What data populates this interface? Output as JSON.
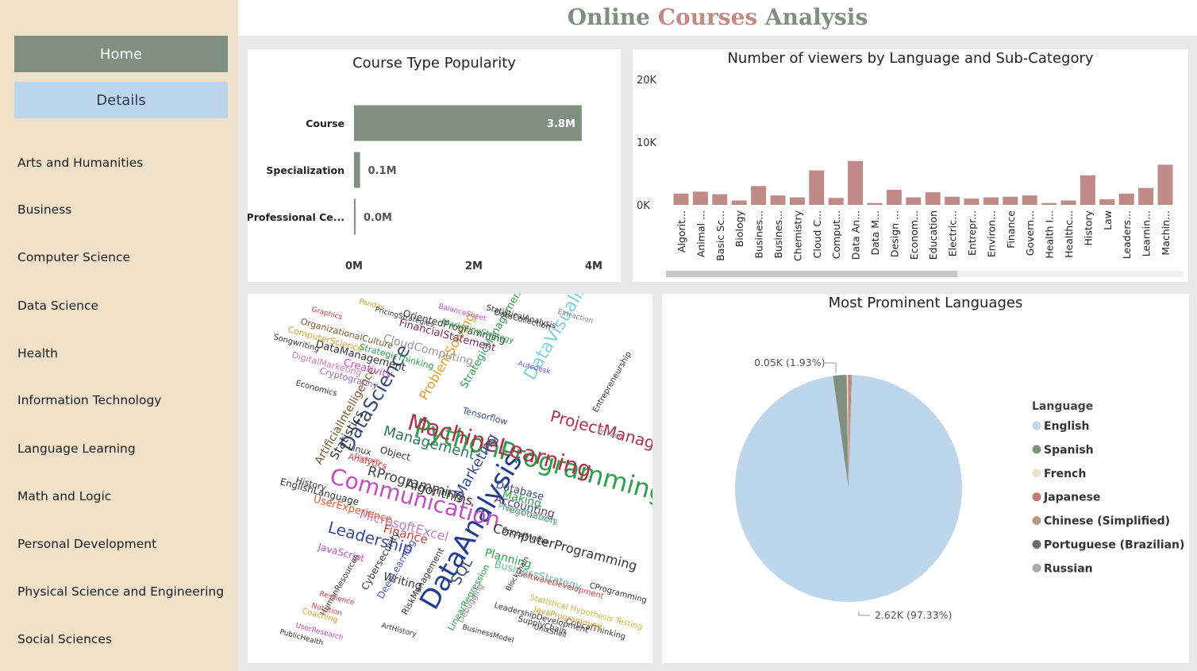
{
  "header": {
    "title_words": [
      "Online",
      "Courses",
      "Analysis"
    ],
    "title_colors": [
      "#7f9080",
      "#c48a86",
      "#7f9080"
    ]
  },
  "sidebar": {
    "home_label": "Home",
    "details_label": "Details",
    "items": [
      {
        "label": "Arts and Humanities"
      },
      {
        "label": "Business"
      },
      {
        "label": "Computer Science"
      },
      {
        "label": "Data Science"
      },
      {
        "label": "Health"
      },
      {
        "label": "Information Technology"
      },
      {
        "label": "Language Learning"
      },
      {
        "label": "Math and Logic"
      },
      {
        "label": "Personal Development"
      },
      {
        "label": "Physical Science and Engineering"
      },
      {
        "label": "Social Sciences"
      }
    ]
  },
  "colors": {
    "bar_green": "#7f9080",
    "bar_rose": "#c08a87",
    "english": "#bdd6ec",
    "spanish": "#7f9080",
    "french": "#f0e1cb",
    "japanese": "#c27c78",
    "chinese": "#b89a86",
    "portuguese": "#6b6b6b",
    "russian": "#aaaaaa"
  },
  "chart_data": [
    {
      "type": "bar",
      "title": "Course Type Popularity",
      "orientation": "horizontal",
      "categories": [
        "Course",
        "Specialization",
        "Professional Ce..."
      ],
      "values": [
        3.8,
        0.1,
        0.0
      ],
      "value_labels": [
        "3.8M",
        "0.1M",
        "0.0M"
      ],
      "xlim": [
        0,
        4
      ],
      "xticks": [
        "0M",
        "2M",
        "4M"
      ]
    },
    {
      "type": "bar",
      "title": "Number of viewers by Language and Sub-Category",
      "categories": [
        "Algorit...",
        "Animal ...",
        "Basic Sc...",
        "Biology",
        "Busines...",
        "Busines...",
        "Chemistry",
        "Cloud C...",
        "Comput...",
        "Data An...",
        "Data M...",
        "Design ...",
        "Econom...",
        "Education",
        "Electric...",
        "Entrepr...",
        "Environ...",
        "Finance",
        "Govern...",
        "Health I...",
        "Healthc...",
        "History",
        "Law",
        "Leaders...",
        "Learnin...",
        "Machin..."
      ],
      "values": [
        1800,
        2100,
        1700,
        700,
        3000,
        1500,
        1200,
        5500,
        1100,
        7000,
        300,
        2400,
        1200,
        2000,
        1300,
        1000,
        1200,
        1300,
        1500,
        300,
        700,
        4700,
        900,
        1800,
        2700,
        6400
      ],
      "ylim": [
        0,
        20000
      ],
      "yticks": [
        "0K",
        "10K",
        "20K"
      ]
    },
    {
      "type": "pie",
      "title": "Most Prominent Languages",
      "legend_title": "Language",
      "legend_position": "right",
      "labels": [
        "English",
        "Spanish",
        "French",
        "Japanese",
        "Chinese (Simplified)",
        "Portuguese (Brazilian)",
        "Russian"
      ],
      "percents": [
        97.33,
        1.93,
        0.2,
        0.3,
        0.12,
        0.07,
        0.05
      ],
      "annotations": [
        "2.62K (97.33%)",
        "0.05K (1.93%)"
      ]
    }
  ],
  "wordcloud": {
    "words": [
      {
        "t": "DataAnalysis",
        "s": 34,
        "c": "#1f3a93",
        "r": -60
      },
      {
        "t": "PythonProgramming",
        "s": 32,
        "c": "#2e9e4a",
        "r": 15
      },
      {
        "t": "MachineLearning",
        "s": 28,
        "c": "#b0304a",
        "r": 15
      },
      {
        "t": "Communication",
        "s": 28,
        "c": "#c04fc0",
        "r": 15
      },
      {
        "t": "DataScience",
        "s": 24,
        "c": "#3a4a7a",
        "r": -60
      },
      {
        "t": "ProjectManagement",
        "s": 20,
        "c": "#b0304a",
        "r": 15
      },
      {
        "t": "DataVisualization",
        "s": 22,
        "c": "#7fd0e0",
        "r": -60
      },
      {
        "t": "Leadership",
        "s": 20,
        "c": "#3a4a9a",
        "r": 15
      },
      {
        "t": "Management",
        "s": 18,
        "c": "#2e7a5a",
        "r": 15
      },
      {
        "t": "ComputerProgramming",
        "s": 16,
        "c": "#333333",
        "r": 15
      },
      {
        "t": "MicrosoftExcel",
        "s": 16,
        "c": "#c080c0",
        "r": 15
      },
      {
        "t": "RProgramming",
        "s": 17,
        "c": "#444444",
        "r": 15
      },
      {
        "t": "Algorithms",
        "s": 16,
        "c": "#333333",
        "r": 15
      },
      {
        "t": "Marketing",
        "s": 18,
        "c": "#3a4a9a",
        "r": -60
      },
      {
        "t": "ProblemSolving",
        "s": 16,
        "c": "#e0a030",
        "r": -60
      },
      {
        "t": "Accounting",
        "s": 14,
        "c": "#5a3a7a",
        "r": 15
      },
      {
        "t": "Finance",
        "s": 15,
        "c": "#d04040",
        "r": 15
      },
      {
        "t": "Statistics",
        "s": 15,
        "c": "#333333",
        "r": -60
      },
      {
        "t": "ArtificialIntelligence",
        "s": 14,
        "c": "#7a5a2a",
        "r": -60
      },
      {
        "t": "UserExperience",
        "s": 13,
        "c": "#e05a30",
        "r": 15
      },
      {
        "t": "DataManagement",
        "s": 13,
        "c": "#333333",
        "r": 15
      },
      {
        "t": "CloudComputing",
        "s": 14,
        "c": "#999999",
        "r": 15
      },
      {
        "t": "StrategicManagement",
        "s": 13,
        "c": "#2e9e4a",
        "r": -60
      },
      {
        "t": "FinancialStatement",
        "s": 13,
        "c": "#7a2a5a",
        "r": 15
      },
      {
        "t": "OrientedProgramming",
        "s": 12,
        "c": "#333333",
        "r": 15
      },
      {
        "t": "Planning",
        "s": 14,
        "c": "#2e9e4a",
        "r": 15
      },
      {
        "t": "BusinessStrategy",
        "s": 13,
        "c": "#60c0a0",
        "r": 15
      },
      {
        "t": "Writing",
        "s": 14,
        "c": "#333333",
        "r": 15
      },
      {
        "t": "Cybersecurity",
        "s": 12,
        "c": "#333333",
        "r": -60
      },
      {
        "t": "DeepLearning",
        "s": 12,
        "c": "#4a5ac0",
        "r": -60
      },
      {
        "t": "Negotiation",
        "s": 12,
        "c": "#888888",
        "r": 15
      },
      {
        "t": "Database",
        "s": 13,
        "c": "#3a4a7a",
        "r": 15
      },
      {
        "t": "Making",
        "s": 14,
        "c": "#2e9e4a",
        "r": 15
      },
      {
        "t": "EnglishLanguage",
        "s": 12,
        "c": "#333333",
        "r": 15
      },
      {
        "t": "Creativity",
        "s": 13,
        "c": "#c04fc0",
        "r": 15
      },
      {
        "t": "Cryptography",
        "s": 11,
        "c": "#9a6ac0",
        "r": 15
      },
      {
        "t": "DigitalMarketing",
        "s": 11,
        "c": "#d080a0",
        "r": 15
      },
      {
        "t": "StrategicThinking",
        "s": 11,
        "c": "#2e9e4a",
        "r": 15
      },
      {
        "t": "JavaScript",
        "s": 12,
        "c": "#c04fc0",
        "r": 15
      },
      {
        "t": "SQL",
        "s": 18,
        "c": "#3a4a7a",
        "r": -60
      },
      {
        "t": "SoftwareDevelopment",
        "s": 10,
        "c": "#d04040",
        "r": 15
      },
      {
        "t": "HumanResources",
        "s": 10,
        "c": "#333333",
        "r": -60
      },
      {
        "t": "RiskManagement",
        "s": 11,
        "c": "#333333",
        "r": -60
      },
      {
        "t": "LinearRegression",
        "s": 11,
        "c": "#2e9e4a",
        "r": -60
      },
      {
        "t": "StatisticalAnalysis",
        "s": 10,
        "c": "#333333",
        "r": 15
      },
      {
        "t": "OrganizationalCulture",
        "s": 11,
        "c": "#7a5a2a",
        "r": 15
      },
      {
        "t": "ComputerScience",
        "s": 11,
        "c": "#e0a030",
        "r": 15
      },
      {
        "t": "MarketingStrategy",
        "s": 10,
        "c": "#2e9e4a",
        "r": 15
      },
      {
        "t": "Economics",
        "s": 10,
        "c": "#333333",
        "r": 15
      },
      {
        "t": "Songwriting",
        "s": 10,
        "c": "#333333",
        "r": 15
      },
      {
        "t": "SupplyChain",
        "s": 10,
        "c": "#333333",
        "r": 15
      },
      {
        "t": "CriticalThinking",
        "s": 10,
        "c": "#333333",
        "r": 15
      },
      {
        "t": "Tensorflow",
        "s": 11,
        "c": "#3a4a9a",
        "r": 15
      },
      {
        "t": "ProjectPlanning",
        "s": 10,
        "c": "#60c0a0",
        "r": 15
      },
      {
        "t": "SocialMedia",
        "s": 10,
        "c": "#333333",
        "r": 15
      },
      {
        "t": "Linux",
        "s": 11,
        "c": "#333333",
        "r": 15
      },
      {
        "t": "Analytics",
        "s": 11,
        "c": "#d04040",
        "r": 15
      },
      {
        "t": "Object",
        "s": 12,
        "c": "#333333",
        "r": 15
      },
      {
        "t": "Debugging",
        "s": 10,
        "c": "#888888",
        "r": -60
      },
      {
        "t": "ArtHistory",
        "s": 9,
        "c": "#333333",
        "r": 15
      },
      {
        "t": "Pandas",
        "s": 9,
        "c": "#e0a030",
        "r": 15
      },
      {
        "t": "Graphics",
        "s": 9,
        "c": "#d04040",
        "r": 15
      },
      {
        "t": "PricingStrategies",
        "s": 9,
        "c": "#333333",
        "r": 15
      },
      {
        "t": "BalanceSheet",
        "s": 9,
        "c": "#c04fc0",
        "r": 15
      },
      {
        "t": "DataCollection",
        "s": 10,
        "c": "#333333",
        "r": 15
      },
      {
        "t": "Extraction",
        "s": 9,
        "c": "#888888",
        "r": 15
      },
      {
        "t": "Autodesk",
        "s": 9,
        "c": "#6a5ac0",
        "r": 15
      },
      {
        "t": "History",
        "s": 11,
        "c": "#333333",
        "r": 15
      },
      {
        "t": "Coaching",
        "s": 10,
        "c": "#e0a030",
        "r": 15
      },
      {
        "t": "Entrepreneurship",
        "s": 10,
        "c": "#333333",
        "r": -60
      },
      {
        "t": "Privacy",
        "s": 9,
        "c": "#888888",
        "r": 15
      },
      {
        "t": "Blockchain",
        "s": 9,
        "c": "#333333",
        "r": -60
      },
      {
        "t": "Statistical Hypothesis Testing",
        "s": 10,
        "c": "#c0c040",
        "r": 15
      },
      {
        "t": "JavaProgramming",
        "s": 10,
        "c": "#e0a030",
        "r": 15
      },
      {
        "t": "LeadershipDevelopment",
        "s": 10,
        "c": "#333333",
        "r": 15
      },
      {
        "t": "CProgramming",
        "s": 10,
        "c": "#333333",
        "r": 15
      },
      {
        "t": "BusinessModel",
        "s": 9,
        "c": "#333333",
        "r": 15
      },
      {
        "t": "UnixShell",
        "s": 9,
        "c": "#333333",
        "r": 15
      },
      {
        "t": "Resilience",
        "s": 9,
        "c": "#d04040",
        "r": 15
      },
      {
        "t": "Nutrition",
        "s": 9,
        "c": "#d04040",
        "r": 15
      },
      {
        "t": "UserResearch",
        "s": 9,
        "c": "#c04fc0",
        "r": 15
      },
      {
        "t": "PublicHealth",
        "s": 9,
        "c": "#333333",
        "r": 15
      },
      {
        "t": "Diversity",
        "s": 8,
        "c": "#d04040",
        "r": 15
      }
    ]
  }
}
